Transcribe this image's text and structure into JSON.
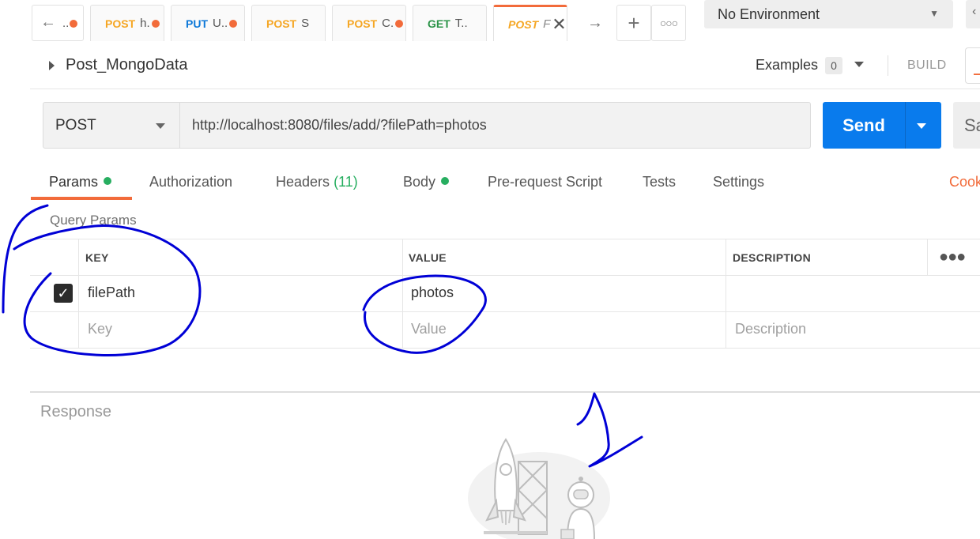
{
  "tabs": [
    {
      "method": "",
      "title": "..",
      "dirty": true
    },
    {
      "method": "POST",
      "title": "h.",
      "dirty": true
    },
    {
      "method": "PUT",
      "title": "U..",
      "dirty": true
    },
    {
      "method": "POST",
      "title": "S",
      "dirty": false
    },
    {
      "method": "POST",
      "title": "C.",
      "dirty": true
    },
    {
      "method": "GET",
      "title": "T..",
      "dirty": false
    },
    {
      "method": "POST",
      "title": "F",
      "dirty": false,
      "active": true
    }
  ],
  "tab_controls": {
    "back_icon": "arrow-left-icon",
    "forward_icon": "arrow-right-icon",
    "add_icon": "plus-icon",
    "more_icon": "more-horizontal-icon"
  },
  "environment": {
    "selected": "No Environment"
  },
  "request": {
    "name": "Post_MongoData",
    "method": "POST",
    "url": "http://localhost:8080/files/add/?filePath=photos"
  },
  "header_actions": {
    "examples_label": "Examples",
    "examples_count": "0",
    "build_label": "BUILD"
  },
  "send": {
    "label": "Send",
    "save_label": "Sa"
  },
  "request_tabs": {
    "params": "Params",
    "authorization": "Authorization",
    "headers": "Headers",
    "headers_count": "(11)",
    "body": "Body",
    "prerequest": "Pre-request Script",
    "tests": "Tests",
    "settings": "Settings",
    "cookies": "Cook"
  },
  "query_params": {
    "label": "Query Params",
    "columns": {
      "key": "KEY",
      "value": "VALUE",
      "description": "DESCRIPTION"
    },
    "rows": [
      {
        "checked": true,
        "key": "filePath",
        "value": "photos",
        "description": ""
      }
    ],
    "placeholders": {
      "key": "Key",
      "value": "Value",
      "description": "Description"
    }
  },
  "response": {
    "label": "Response"
  },
  "colors": {
    "accent": "#f26b3a",
    "send_blue": "#097bed",
    "active_green": "#27ae60",
    "annotation_blue": "#0000d6"
  }
}
